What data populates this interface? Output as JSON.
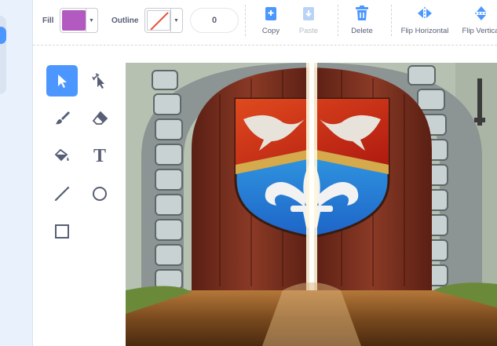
{
  "toolbar": {
    "fill_label": "Fill",
    "fill_color": "#b35ac0",
    "outline_label": "Outline",
    "outline_width": "0",
    "actions": [
      {
        "label": "Copy",
        "icon": "copy-icon",
        "enabled": true
      },
      {
        "label": "Paste",
        "icon": "paste-icon",
        "enabled": false
      },
      {
        "label": "Delete",
        "icon": "trash-icon",
        "enabled": true
      },
      {
        "label": "Flip Horizontal",
        "icon": "flip-horizontal-icon",
        "enabled": true
      },
      {
        "label": "Flip Vertical",
        "icon": "flip-vertical-icon",
        "enabled": true
      }
    ]
  },
  "tools": [
    {
      "name": "select",
      "icon": "arrow-cursor-icon",
      "active": true
    },
    {
      "name": "reshape",
      "icon": "reshape-icon",
      "active": false
    },
    {
      "name": "brush",
      "icon": "brush-icon",
      "active": false
    },
    {
      "name": "eraser",
      "icon": "eraser-icon",
      "active": false
    },
    {
      "name": "fill",
      "icon": "paint-bucket-icon",
      "active": false
    },
    {
      "name": "text",
      "icon": "text-icon",
      "active": false,
      "glyph": "T"
    },
    {
      "name": "line",
      "icon": "line-icon",
      "active": false
    },
    {
      "name": "circle",
      "icon": "circle-icon",
      "active": false
    },
    {
      "name": "rectangle",
      "icon": "rectangle-icon",
      "active": false
    }
  ],
  "colors": {
    "accent": "#4c97ff",
    "text": "#575e75",
    "disabled": "#b6bac3",
    "delete": "#4c97ff"
  },
  "canvas": {
    "content": "castle-door-costume"
  }
}
